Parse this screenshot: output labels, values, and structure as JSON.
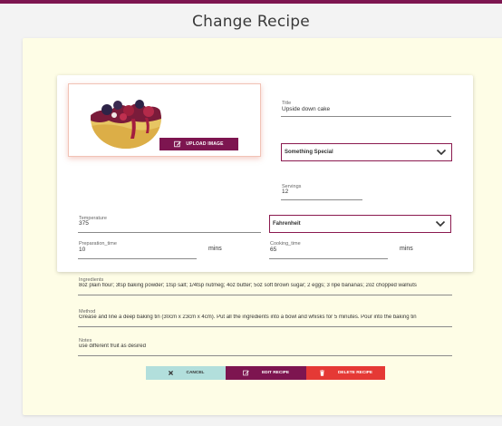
{
  "colors": {
    "accent": "#7d1550",
    "delete": "#e53935",
    "cancel": "#b2dfdc",
    "panel": "#fefde6"
  },
  "page": {
    "title": "Change Recipe"
  },
  "image": {
    "upload_label": "UPLOAD IMAGE",
    "upload_icon": "edit-icon"
  },
  "form": {
    "title_label": "Title",
    "title_value": "Upside down cake",
    "category_value": "Something Special",
    "servings_label": "Servings",
    "servings_value": "12",
    "temperature_label": "Temperature",
    "temperature_value": "375",
    "temperature_unit": "Fahrenheit",
    "prep_label": "Preparation_time",
    "prep_value": "10",
    "prep_unit": "mins",
    "cook_label": "Cooking_time",
    "cook_value": "65",
    "cook_unit": "mins",
    "ingredients_label": "Ingredients",
    "ingredients_value": "8oz plain flour; 3tsp baking powder; 1tsp salt; 1/4tsp nutmeg; 4oz butter; 5oz soft brown sugar; 2 eggs; 3 ripe bananas; 2oz chopped walnuts",
    "method_label": "Method",
    "method_value": "Grease and line a deep baking tin (30cm x 23cm x 4cm).  Put all the ingredients into a bowl and whisks for 5 minutes. Pour into the baking tin",
    "notes_label": "Notes",
    "notes_value": "use different fruit as desired"
  },
  "actions": {
    "cancel_label": "CANCEL",
    "edit_label": "EDIT RECIPE",
    "delete_label": "DELETE RECIPE"
  }
}
